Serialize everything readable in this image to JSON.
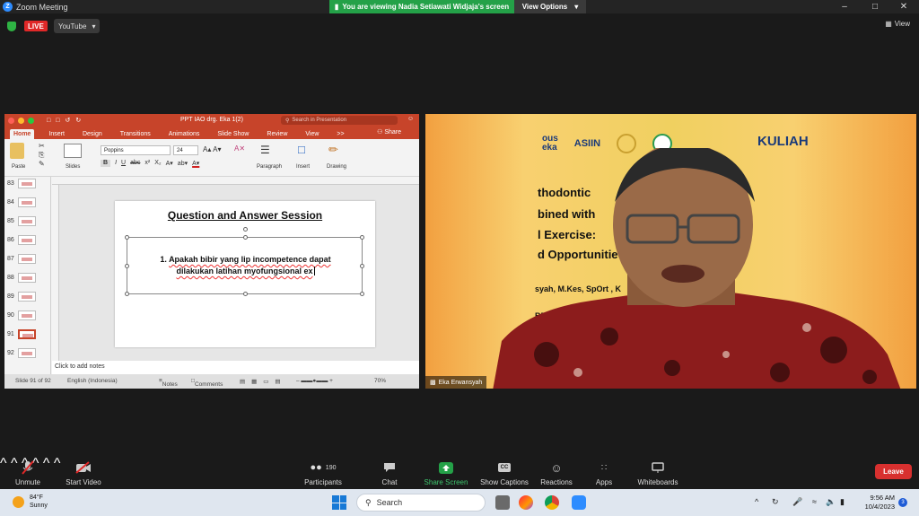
{
  "window": {
    "title": "Zoom Meeting"
  },
  "banner": {
    "viewing_text": "You are viewing Nadia Setiawati Widjaja's screen",
    "view_options": "View Options"
  },
  "topbar": {
    "live": "LIVE",
    "stream_target": "YouTube",
    "view": "View"
  },
  "powerpoint": {
    "doc_title": "PPT IAO drg. Eka 1(2)",
    "search_placeholder": "Search in Presentation",
    "tabs": [
      "Home",
      "Insert",
      "Design",
      "Transitions",
      "Animations",
      "Slide Show",
      "Review",
      "View",
      ">>"
    ],
    "share": "Share",
    "ribbon": {
      "paste": "Paste",
      "slides": "Slides",
      "font": "Poppins",
      "size": "24",
      "paragraph": "Paragraph",
      "insert": "Insert",
      "drawing": "Drawing"
    },
    "thumbnails": [
      "83",
      "84",
      "85",
      "86",
      "87",
      "88",
      "89",
      "90",
      "91",
      "92"
    ],
    "active_slide": "91",
    "slide": {
      "title": "Question and Answer Session",
      "line1_prefix": "1.",
      "line1": "Apakah bibir yang lip incompetence dapat",
      "line2": "dilakukan latihan myofungsional ex"
    },
    "notes_placeholder": "Click to add notes",
    "status": {
      "slide": "Slide 91 of 92",
      "language": "English (Indonesia)",
      "notes": "Notes",
      "comments": "Comments",
      "zoom": "70%"
    }
  },
  "video": {
    "participant_name": "Eka Erwansyah",
    "bg_logo1": "ous\neka",
    "bg_asiin": "ASIIN",
    "bg_kuliah": "KULIAH",
    "bg_lines": [
      "thodontic",
      "bined with",
      "l Exercise:",
      "d Opportunitie",
      "syah, M.Kes, SpOrt , K",
      "BER 2"
    ]
  },
  "toolbar": {
    "unmute": "Unmute",
    "start_video": "Start Video",
    "participants": "Participants",
    "participants_count": "190",
    "chat": "Chat",
    "share_screen": "Share Screen",
    "show_captions": "Show Captions",
    "reactions": "Reactions",
    "apps": "Apps",
    "whiteboards": "Whiteboards",
    "leave": "Leave"
  },
  "taskbar": {
    "temp": "84°F",
    "weather": "Sunny",
    "search": "Search",
    "time": "9:56 AM",
    "date": "10/4/2023",
    "notifications": "3"
  },
  "colors": {
    "zoom_green": "#24a148",
    "ppt_red": "#c7442a",
    "leave_red": "#d8302f"
  }
}
